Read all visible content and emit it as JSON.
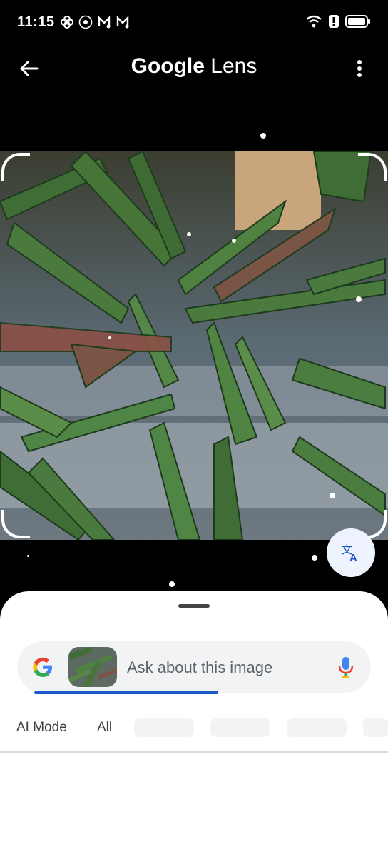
{
  "status_bar": {
    "time": "11:15",
    "icons": [
      "pinwheel-icon",
      "absa-icon",
      "m-music-icon",
      "m-music-icon"
    ],
    "right_icons": [
      "wifi-icon",
      "alert-icon",
      "battery-icon"
    ]
  },
  "app_bar": {
    "title_brand": "Google",
    "title_product": " Lens"
  },
  "search": {
    "placeholder": "Ask about this image",
    "progress_fraction": 0.52
  },
  "tabs": [
    {
      "label": "AI Mode"
    },
    {
      "label": "All"
    }
  ],
  "colors": {
    "accent": "#1a57c8",
    "sheet_bg": "#ffffff",
    "search_bg": "#f1f3f4",
    "translate_bg": "#eef3fe"
  }
}
